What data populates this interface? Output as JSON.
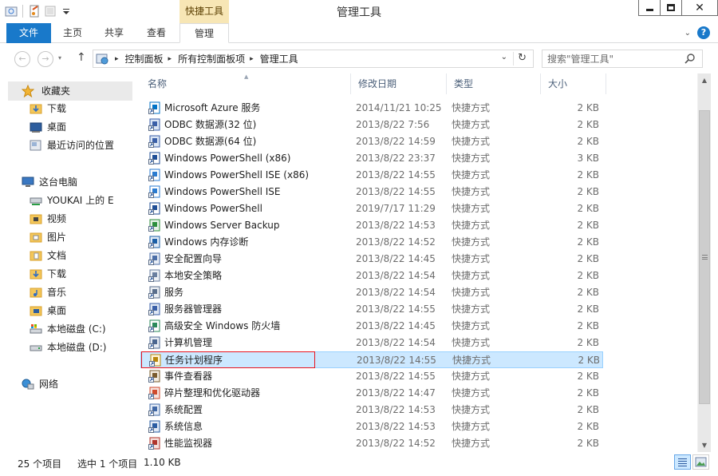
{
  "window": {
    "title": "管理工具",
    "context_tab_header": "快捷工具"
  },
  "ribbon": {
    "tabs": [
      {
        "label": "文件"
      },
      {
        "label": "主页"
      },
      {
        "label": "共享"
      },
      {
        "label": "查看"
      },
      {
        "label": "管理"
      }
    ],
    "help_glyph": "?"
  },
  "address": {
    "breadcrumbs": [
      "控制面板",
      "所有控制面板项",
      "管理工具"
    ],
    "separator": "▸"
  },
  "search": {
    "placeholder": "搜索\"管理工具\""
  },
  "nav": {
    "favorites": "收藏夹",
    "fav_items": [
      "下载",
      "桌面",
      "最近访问的位置"
    ],
    "this_pc": "这台电脑",
    "pc_items": [
      "YOUKAI 上的 E",
      "视频",
      "图片",
      "文档",
      "下载",
      "音乐",
      "桌面",
      "本地磁盘 (C:)",
      "本地磁盘 (D:)"
    ],
    "network": "网络"
  },
  "columns": {
    "name": "名称",
    "date": "修改日期",
    "type": "类型",
    "size": "大小"
  },
  "files": [
    {
      "name": "Microsoft Azure 服务",
      "date": "2014/11/21 10:25",
      "type": "快捷方式",
      "size": "2 KB",
      "icon": "azure-icon"
    },
    {
      "name": "ODBC 数据源(32 位)",
      "date": "2013/8/22 7:56",
      "type": "快捷方式",
      "size": "2 KB",
      "icon": "odbc-icon"
    },
    {
      "name": "ODBC 数据源(64 位)",
      "date": "2013/8/22 14:59",
      "type": "快捷方式",
      "size": "2 KB",
      "icon": "odbc-icon"
    },
    {
      "name": "Windows PowerShell (x86)",
      "date": "2013/8/22 23:37",
      "type": "快捷方式",
      "size": "3 KB",
      "icon": "powershell-icon"
    },
    {
      "name": "Windows PowerShell ISE (x86)",
      "date": "2013/8/22 14:55",
      "type": "快捷方式",
      "size": "2 KB",
      "icon": "powershell-ise-icon"
    },
    {
      "name": "Windows PowerShell ISE",
      "date": "2013/8/22 14:55",
      "type": "快捷方式",
      "size": "2 KB",
      "icon": "powershell-ise-icon"
    },
    {
      "name": "Windows PowerShell",
      "date": "2019/7/17 11:29",
      "type": "快捷方式",
      "size": "2 KB",
      "icon": "powershell-icon"
    },
    {
      "name": "Windows Server Backup",
      "date": "2013/8/22 14:53",
      "type": "快捷方式",
      "size": "2 KB",
      "icon": "backup-icon"
    },
    {
      "name": "Windows 内存诊断",
      "date": "2013/8/22 14:52",
      "type": "快捷方式",
      "size": "2 KB",
      "icon": "memory-diagnostic-icon"
    },
    {
      "name": "安全配置向导",
      "date": "2013/8/22 14:45",
      "type": "快捷方式",
      "size": "2 KB",
      "icon": "security-wizard-icon"
    },
    {
      "name": "本地安全策略",
      "date": "2013/8/22 14:54",
      "type": "快捷方式",
      "size": "2 KB",
      "icon": "security-policy-icon"
    },
    {
      "name": "服务",
      "date": "2013/8/22 14:54",
      "type": "快捷方式",
      "size": "2 KB",
      "icon": "services-icon"
    },
    {
      "name": "服务器管理器",
      "date": "2013/8/22 14:55",
      "type": "快捷方式",
      "size": "2 KB",
      "icon": "server-manager-icon"
    },
    {
      "name": "高级安全 Windows 防火墙",
      "date": "2013/8/22 14:45",
      "type": "快捷方式",
      "size": "2 KB",
      "icon": "firewall-icon"
    },
    {
      "name": "计算机管理",
      "date": "2013/8/22 14:54",
      "type": "快捷方式",
      "size": "2 KB",
      "icon": "computer-management-icon"
    },
    {
      "name": "任务计划程序",
      "date": "2013/8/22 14:55",
      "type": "快捷方式",
      "size": "2 KB",
      "icon": "task-scheduler-icon",
      "selected": true
    },
    {
      "name": "事件查看器",
      "date": "2013/8/22 14:55",
      "type": "快捷方式",
      "size": "2 KB",
      "icon": "event-viewer-icon"
    },
    {
      "name": "碎片整理和优化驱动器",
      "date": "2013/8/22 14:47",
      "type": "快捷方式",
      "size": "2 KB",
      "icon": "defrag-icon"
    },
    {
      "name": "系统配置",
      "date": "2013/8/22 14:53",
      "type": "快捷方式",
      "size": "2 KB",
      "icon": "msconfig-icon"
    },
    {
      "name": "系统信息",
      "date": "2013/8/22 14:53",
      "type": "快捷方式",
      "size": "2 KB",
      "icon": "system-info-icon"
    },
    {
      "name": "性能监视器",
      "date": "2013/8/22 14:52",
      "type": "快捷方式",
      "size": "2 KB",
      "icon": "performance-monitor-icon"
    }
  ],
  "status": {
    "item_count": "25 个项目",
    "selection": "选中 1 个项目",
    "selection_size": "1.10 KB"
  },
  "colors": {
    "accent": "#1979ca",
    "selection_bg": "#cce8ff",
    "selection_border": "#99d1ff",
    "highlight_box": "#e8141e",
    "context_tab": "#f7e6b5"
  }
}
